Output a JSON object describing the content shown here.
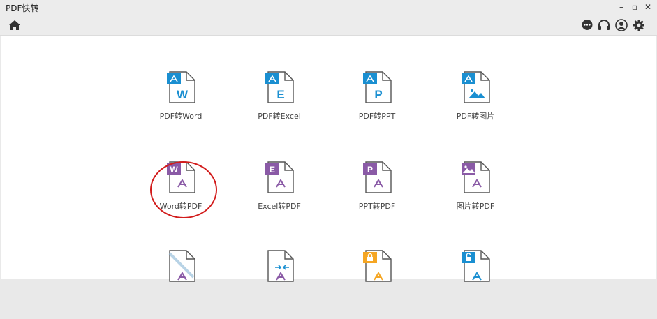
{
  "app": {
    "title": "PDF快转"
  },
  "window_controls": [
    "–",
    "▫",
    "✕"
  ],
  "toolbar": {
    "home_icon": "home-icon",
    "right_icons": [
      "chat-icon",
      "headset-icon",
      "user-icon",
      "gear-icon"
    ]
  },
  "colors": {
    "blue": "#1a8fd1",
    "purple": "#8a5aa6",
    "orange": "#f5a623",
    "red_ring": "#d21c1c"
  },
  "tiles_row1": [
    {
      "label": "PDF转Word",
      "letter": "W"
    },
    {
      "label": "PDF转Excel",
      "letter": "E"
    },
    {
      "label": "PDF转PPT",
      "letter": "P"
    },
    {
      "label": "PDF转图片",
      "letter": ""
    }
  ],
  "tiles_row2": [
    {
      "label": "Word转PDF",
      "letter": "W"
    },
    {
      "label": "Excel转PDF",
      "letter": "E"
    },
    {
      "label": "PPT转PDF",
      "letter": "P"
    },
    {
      "label": "图片转PDF",
      "letter": ""
    }
  ]
}
